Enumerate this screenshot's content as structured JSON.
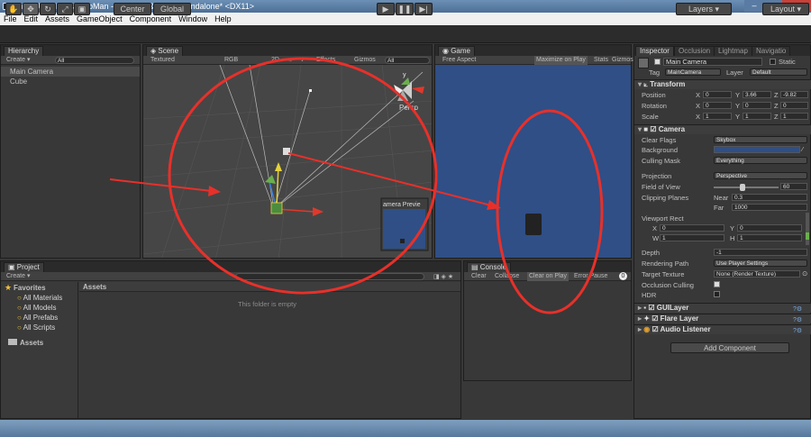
{
  "window": {
    "title": "Unity - Untitled - JumpMan - PC, Mac & Linux Standalone* <DX11>",
    "min": "–",
    "max": "□",
    "close": "✕"
  },
  "menu": [
    "File",
    "Edit",
    "Assets",
    "GameObject",
    "Component",
    "Window",
    "Help"
  ],
  "toolbar": {
    "center": "Center",
    "global": "Global",
    "layers": "Layers",
    "layout": "Layout"
  },
  "hierarchy": {
    "tab": "Hierarchy",
    "create": "Create ▾",
    "search": "All",
    "items": [
      "Main Camera",
      "Cube"
    ]
  },
  "scene": {
    "tab": "Scene",
    "shading": "Textured",
    "rgb": "RGB",
    "mode2d": "2D",
    "effects": "Effects",
    "gizmos": "Gizmos",
    "search": "All",
    "persp": "Persp",
    "preview_title": "amera Previe",
    "axis_y": "y"
  },
  "game": {
    "tab": "Game",
    "aspect": "Free Aspect",
    "maximize": "Maximize on Play",
    "stats": "Stats",
    "gizmos": "Gizmos"
  },
  "project": {
    "tab": "Project",
    "create": "Create ▾",
    "favorites": "Favorites",
    "fav_items": [
      "All Materials",
      "All Models",
      "All Prefabs",
      "All Scripts"
    ],
    "assets_folder": "Assets",
    "assets_header": "Assets",
    "empty": "This folder is empty"
  },
  "console": {
    "tab": "Console",
    "clear": "Clear",
    "collapse": "Collapse",
    "clear_on_play": "Clear on Play",
    "error_pause": "Error Pause",
    "count": "0"
  },
  "inspector": {
    "tabs": [
      "Inspector",
      "Occlusion",
      "Lightmap",
      "Navigatio"
    ],
    "name": "Main Camera",
    "static": "Static",
    "tag_label": "Tag",
    "tag": "MainCamera",
    "layer_label": "Layer",
    "layer": "Default",
    "transform": {
      "title": "Transform",
      "position": {
        "label": "Position",
        "x": "0",
        "y": "3.66",
        "z": "-9.82"
      },
      "rotation": {
        "label": "Rotation",
        "x": "0",
        "y": "0",
        "z": "0"
      },
      "scale": {
        "label": "Scale",
        "x": "1",
        "y": "1",
        "z": "1"
      }
    },
    "camera": {
      "title": "Camera",
      "clear_flags_label": "Clear Flags",
      "clear_flags": "Skybox",
      "background_label": "Background",
      "culling_label": "Culling Mask",
      "culling": "Everything",
      "projection_label": "Projection",
      "projection": "Perspective",
      "fov_label": "Field of View",
      "fov": "60",
      "clip_label": "Clipping Planes",
      "near_label": "Near",
      "near": "0.3",
      "far_label": "Far",
      "far": "1000",
      "viewport_label": "Viewport Rect",
      "vx": "0",
      "vy": "0",
      "vw": "1",
      "vh": "1",
      "depth_label": "Depth",
      "depth": "-1",
      "render_path_label": "Rendering Path",
      "render_path": "Use Player Settings",
      "target_label": "Target Texture",
      "target": "None (Render Texture)",
      "occlusion_label": "Occlusion Culling",
      "hdr_label": "HDR"
    },
    "gui_layer": "GUILayer",
    "flare_layer": "Flare Layer",
    "audio_listener": "Audio Listener",
    "add_component": "Add Component"
  },
  "colors": {
    "game_bg": "#2f4f86",
    "annotation": "#e8302a",
    "bg_color": "#2f4f86"
  }
}
